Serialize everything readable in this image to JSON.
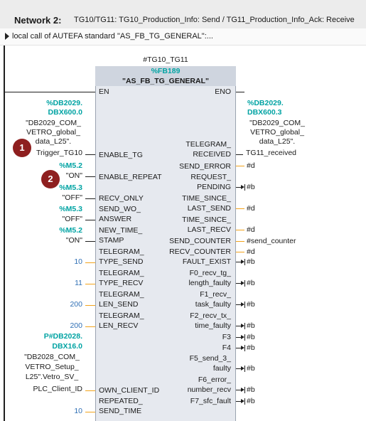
{
  "network": {
    "title": "Network 2:",
    "description": "TG10/TG11: TG10_Production_Info: Send / TG11_Production_Info_Ack: Receive",
    "comment": "local call of AUTEFA standard \"AS_FB_TG_GENERAL\":..."
  },
  "block": {
    "instance": "#TG10_TG11",
    "number": "%FB189",
    "name": "\"AS_FB_TG_GENERAL\""
  },
  "pins": {
    "en": "EN",
    "eno": "ENO",
    "enable_tg": "ENABLE_TG",
    "enable_repeat": "ENABLE_REPEAT",
    "recv_only": "RECV_ONLY",
    "send_wo_1": "SEND_WO_",
    "send_wo_2": "ANSWER",
    "new_time_1": "NEW_TIME_",
    "new_time_2": "STAMP",
    "tts_1": "TELEGRAM_",
    "tts_2": "TYPE_SEND",
    "ttr_1": "TELEGRAM_",
    "ttr_2": "TYPE_RECV",
    "tls_1": "TELEGRAM_",
    "tls_2": "LEN_SEND",
    "tlr_1": "TELEGRAM_",
    "tlr_2": "LEN_RECV",
    "own_client_id": "OWN_CLIENT_ID",
    "repeated_1": "REPEATED_",
    "repeated_2": "SEND_TIME",
    "tg_received_1": "TELEGRAM_",
    "tg_received_2": "RECEIVED",
    "send_error": "SEND_ERROR",
    "req_pending_1": "REQUEST_",
    "req_pending_2": "PENDING",
    "tsls_1": "TIME_SINCE_",
    "tsls_2": "LAST_SEND",
    "tslr_1": "TIME_SINCE_",
    "tslr_2": "LAST_RECV",
    "send_counter": "SEND_COUNTER",
    "recv_counter": "RECV_COUNTER",
    "fault_exist": "FAULT_EXIST",
    "f0_1": "F0_recv_tg_",
    "f0_2": "length_faulty",
    "f1_1": "F1_recv_",
    "f1_2": "task_faulty",
    "f2_1": "F2_recv_tx_",
    "f2_2": "time_faulty",
    "f3": "F3",
    "f4": "F4",
    "f5_1": "F5_send_3_",
    "f5_2": "faulty",
    "f6_1": "F6_error_",
    "f6_2": "number_recv",
    "f7": "F7_sfc_fault"
  },
  "inputs": {
    "in_db_addr_1": "%DB2029.",
    "in_db_addr_2": "DBX600.0",
    "in_db_sym_1": "\"DB2029_COM_",
    "in_db_sym_2": "VETRO_global_",
    "in_db_sym_3": "data_L25\".",
    "in_db_sym_4": "Trigger_TG10",
    "m52_a": "%M5.2",
    "on_a": "\"ON\"",
    "m53_a": "%M5.3",
    "off_a": "\"OFF\"",
    "m53_b": "%M5.3",
    "off_b": "\"OFF\"",
    "m52_b": "%M5.2",
    "on_b": "\"ON\"",
    "tts_val": "10",
    "ttr_val": "11",
    "tls_val": "200",
    "tlr_val": "200",
    "own_db_addr_1": "P#DB2028.",
    "own_db_addr_2": "DBX16.0",
    "own_db_sym_1": "\"DB2028_COM_",
    "own_db_sym_2": "VETRO_Setup_",
    "own_db_sym_3": "L25\".Vetro_SV_",
    "own_db_sym_4": "PLC_Client_ID",
    "repeated_val": "10"
  },
  "outputs": {
    "out_db_addr_1": "%DB2029.",
    "out_db_addr_2": "DBX600.3",
    "out_db_sym_1": "\"DB2029_COM_",
    "out_db_sym_2": "VETRO_global_",
    "out_db_sym_3": "data_L25\".",
    "out_db_sym_4": "TG11_received",
    "send_error_val": "#d",
    "req_pending_val": "#b",
    "tsls_val": "#d",
    "tslr_val": "#d",
    "send_counter_val": "#send_counter",
    "recv_counter_val": "#d",
    "fault_exist_val": "#b",
    "f0_val": "#b",
    "f1_val": "#b",
    "f2_val": "#b",
    "f3_val": "#b",
    "f4_val": "#b",
    "f5_val": "#b",
    "f6_val": "#b",
    "f7_val": "#b"
  },
  "badges": {
    "b1": "1",
    "b2": "2"
  }
}
